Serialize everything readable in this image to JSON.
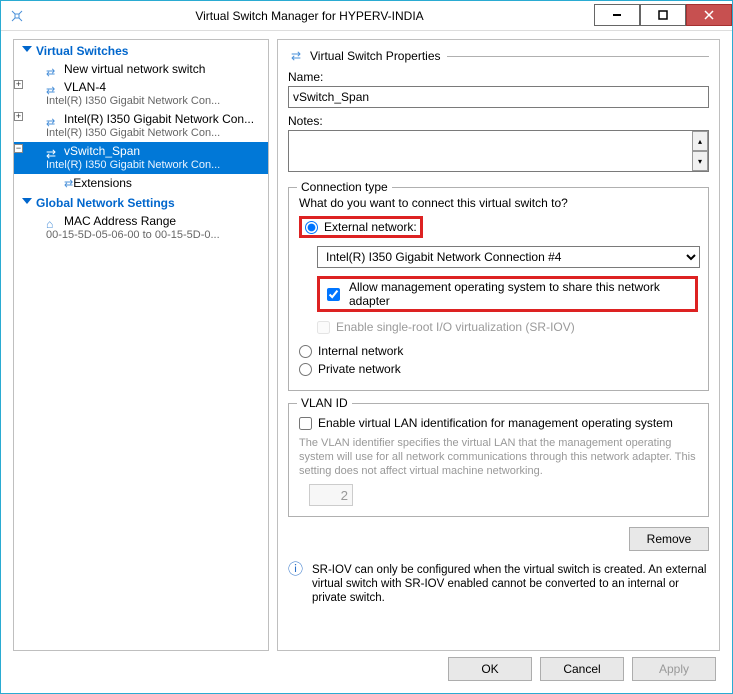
{
  "window": {
    "title": "Virtual Switch Manager for HYPERV-INDIA"
  },
  "tree": {
    "section_switches": "Virtual Switches",
    "new_switch": "New virtual network switch",
    "items": [
      {
        "name": "VLAN-4",
        "detail": "Intel(R) I350 Gigabit Network Con..."
      },
      {
        "name": "Intel(R) I350 Gigabit Network Con...",
        "detail": "Intel(R) I350 Gigabit Network Con..."
      },
      {
        "name": "vSwitch_Span",
        "detail": "Intel(R) I350 Gigabit Network Con..."
      }
    ],
    "extensions": "Extensions",
    "section_global": "Global Network Settings",
    "mac_range_label": "MAC Address Range",
    "mac_range_detail": "00-15-5D-05-06-00 to 00-15-5D-0..."
  },
  "props": {
    "heading": "Virtual Switch Properties",
    "name_label": "Name:",
    "name_value": "vSwitch_Span",
    "notes_label": "Notes:",
    "notes_value": ""
  },
  "conn": {
    "legend": "Connection type",
    "question": "What do you want to connect this virtual switch to?",
    "external_label": "External network:",
    "adapter": "Intel(R) I350 Gigabit Network Connection #4",
    "allow_mgmt": "Allow management operating system to share this network adapter",
    "sriov_enable": "Enable single-root I/O virtualization (SR-IOV)",
    "internal_label": "Internal network",
    "private_label": "Private network"
  },
  "vlan": {
    "legend": "VLAN ID",
    "enable_label": "Enable virtual LAN identification for management operating system",
    "help": "The VLAN identifier specifies the virtual LAN that the management operating system will use for all network communications through this network adapter. This setting does not affect virtual machine networking.",
    "value": "2"
  },
  "buttons": {
    "remove": "Remove",
    "ok": "OK",
    "cancel": "Cancel",
    "apply": "Apply"
  },
  "info": {
    "sriov_note": "SR-IOV can only be configured when the virtual switch is created. An external virtual switch with SR-IOV enabled cannot be converted to an internal or private switch."
  }
}
